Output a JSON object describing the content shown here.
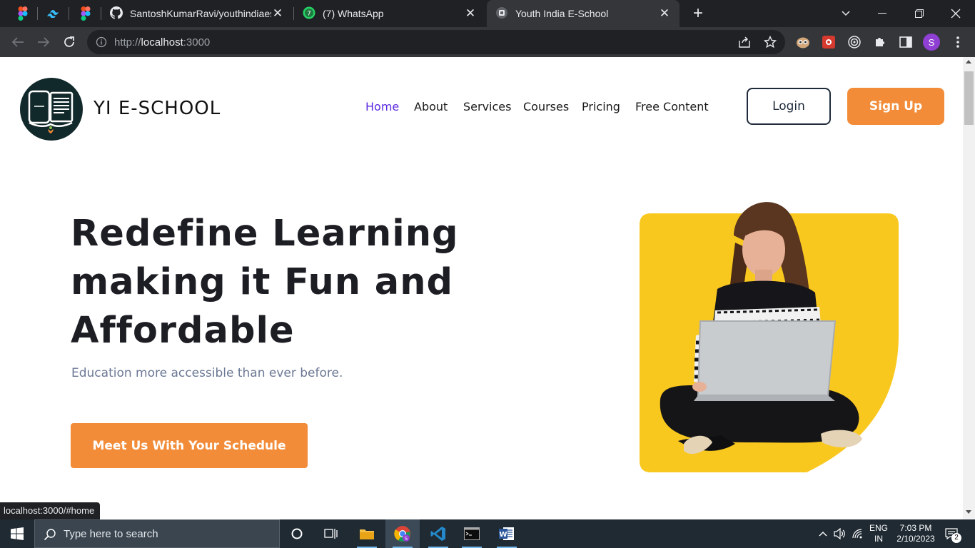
{
  "browser": {
    "tabs": [
      {
        "title": "SantoshKumarRavi/youthindiaeschool",
        "icon": "github-icon"
      },
      {
        "title": "(7) WhatsApp",
        "icon": "whatsapp-icon"
      },
      {
        "title": "Youth India E-School",
        "icon": "site-favicon"
      }
    ],
    "url_scheme": "http://",
    "url_host": "localhost",
    "url_port": ":3000",
    "profile_initial": "S",
    "status_url": "localhost:3000/#home"
  },
  "site": {
    "brand": "YI E-SCHOOL",
    "nav": [
      "Home",
      "About",
      "Services",
      "Courses",
      "Pricing",
      "Free Content"
    ],
    "active_nav": "Home",
    "login_label": "Login",
    "signup_label": "Sign Up",
    "hero_title": "Redefine Learning making it Fun and Affordable",
    "hero_subtitle": "Education more accessible than ever before.",
    "cta_label": "Meet Us With Your Schedule",
    "colors": {
      "accent": "#f28c38",
      "nav_active": "#5b2ae0",
      "hero_panel": "#f9c81f",
      "logo_bg": "#12292b"
    }
  },
  "taskbar": {
    "search_placeholder": "Type here to search",
    "lang_line1": "ENG",
    "lang_line2": "IN",
    "time": "7:03 PM",
    "date": "2/10/2023",
    "notification_count": "2"
  }
}
